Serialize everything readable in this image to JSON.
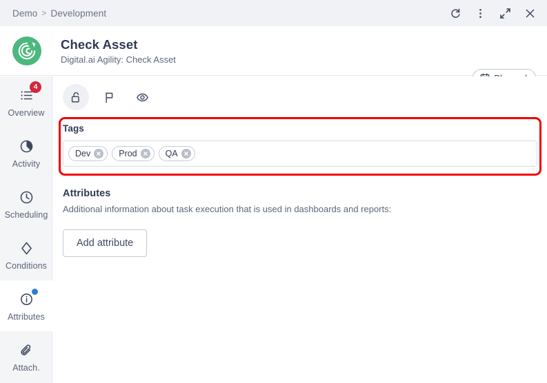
{
  "window": {
    "breadcrumb": {
      "root": "Demo",
      "separator": ">",
      "current": "Development"
    },
    "actions": [
      {
        "name": "refresh-button",
        "icon": "refresh-icon",
        "label": "Refresh"
      },
      {
        "name": "more-options-button",
        "icon": "kebab-menu-icon",
        "label": "More options"
      },
      {
        "name": "expand-button",
        "icon": "expand-icon",
        "label": "Expand"
      },
      {
        "name": "close-button",
        "icon": "close-icon",
        "label": "Close"
      }
    ]
  },
  "header": {
    "logo": "agility-refresh-logo",
    "logo_color": "#4cb87d",
    "title": "Check Asset",
    "subtitle": "Digital.ai Agility: Check Asset",
    "status_badge": {
      "label": "Planned",
      "icon": "calendar-icon"
    }
  },
  "sidebar": {
    "items": [
      {
        "label": "Overview",
        "icon": "list-icon",
        "badge_count": "4",
        "active": false
      },
      {
        "label": "Activity",
        "icon": "pie-chart-icon",
        "badge_count": "",
        "active": false
      },
      {
        "label": "Scheduling",
        "icon": "clock-icon",
        "badge_count": "",
        "active": false
      },
      {
        "label": "Conditions",
        "icon": "diamond-icon",
        "badge_count": "",
        "active": false
      },
      {
        "label": "Attributes",
        "icon": "info-icon",
        "badge_count": "",
        "active": true,
        "badge_dot": true
      },
      {
        "label": "Attach.",
        "icon": "paperclip-icon",
        "badge_count": "",
        "active": false
      }
    ]
  },
  "content": {
    "toolbar": [
      {
        "name": "unlock-button",
        "icon": "unlock-icon",
        "label": "Unlock",
        "hovered": true
      },
      {
        "name": "flag-button",
        "icon": "flag-icon",
        "label": "Flag",
        "hovered": false
      },
      {
        "name": "preview-button",
        "icon": "eye-icon",
        "label": "Preview",
        "hovered": false
      }
    ],
    "tags": {
      "label": "Tags",
      "chips": [
        {
          "label": "Dev"
        },
        {
          "label": "Prod"
        },
        {
          "label": "QA"
        }
      ]
    },
    "attributes": {
      "title": "Attributes",
      "description": "Additional information about task execution that is used in dashboards and reports:",
      "add_button_label": "Add attribute"
    },
    "highlight_color": "#ee0000"
  }
}
